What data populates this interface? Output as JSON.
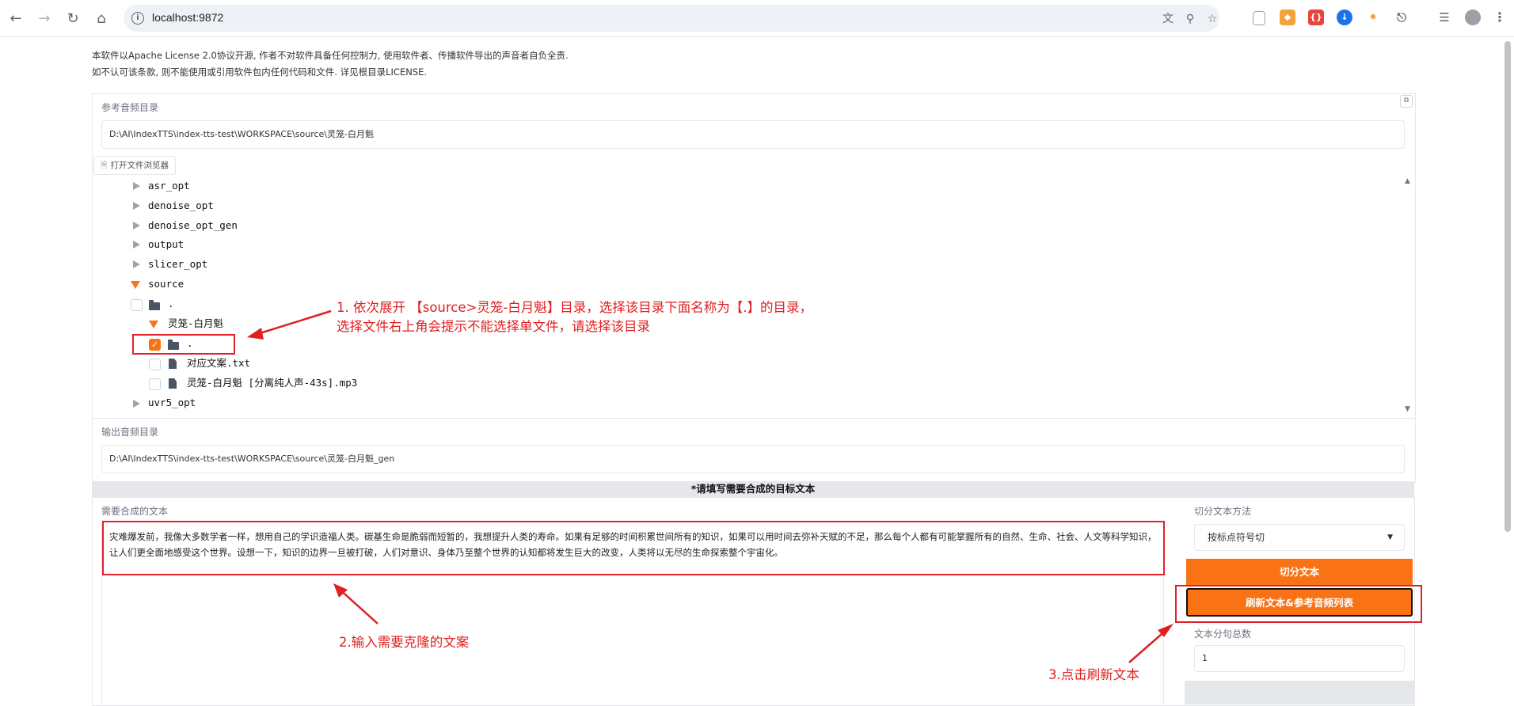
{
  "browser": {
    "url": "localhost:9872",
    "nav_icons": [
      "back-icon",
      "forward-icon",
      "reload-icon",
      "home-icon"
    ]
  },
  "notice": {
    "line1": "本软件以Apache License 2.0协议开源, 作者不对软件具备任何控制力, 使用软件者、传播软件导出的声音者自负全责.",
    "line2": "如不认可该条款, 则不能使用或引用软件包内任何代码和文件. 详见根目录LICENSE."
  },
  "ref_dir": {
    "label": "参考音频目录",
    "value": "D:\\AI\\IndexTTS\\index-tts-test\\WORKSPACE\\source\\灵笼-白月魁",
    "browse_button": "打开文件浏览器"
  },
  "tree": {
    "folders": [
      "asr_opt",
      "denoise_opt",
      "denoise_opt_gen",
      "output",
      "slicer_opt",
      "source"
    ],
    "source_children": {
      "dot": ".",
      "sub": "灵笼-白月魁",
      "sub_dot": ".",
      "files": [
        "对应文案.txt",
        "灵笼-白月魁 [分离纯人声-43s].mp3"
      ]
    },
    "last": "uvr5_opt"
  },
  "out_dir": {
    "label": "输出音频目录",
    "value": "D:\\AI\\IndexTTS\\index-tts-test\\WORKSPACE\\source\\灵笼-白月魁_gen"
  },
  "section_title": "*请填写需要合成的目标文本",
  "text_input": {
    "label": "需要合成的文本",
    "value": "灾难爆发前，我像大多数学者一样，想用自己的学识造福人类。碳基生命是脆弱而短暂的，我想提升人类的寿命。如果有足够的时间积累世间所有的知识，如果可以用时间去弥补天赋的不足，那么每个人都有可能掌握所有的自然、生命、社会、人文等科学知识，让人们更全面地感受这个世界。设想一下，知识的边界一旦被打破，人们对意识、身体乃至整个世界的认知都将发生巨大的改变，人类将以无尽的生命探索整个宇宙化。"
  },
  "right_panel": {
    "split_label": "切分文本方法",
    "split_value": "按标点符号切",
    "split_button": "切分文本",
    "refresh_button": "刷新文本&参考音频列表",
    "count_label": "文本分句总数",
    "count_value": "1"
  },
  "annotations": {
    "a1_line1": "1. 依次展开 【source>灵笼-白月魁】目录，选择该目录下面名称为【.】的目录，",
    "a1_line2": "选择文件右上角会提示不能选择单文件，请选择该目录",
    "a2": "2.输入需要克隆的文案",
    "a3": "3.点击刷新文本"
  },
  "colors": {
    "accent": "#f97316",
    "annotation": "#e02020"
  }
}
